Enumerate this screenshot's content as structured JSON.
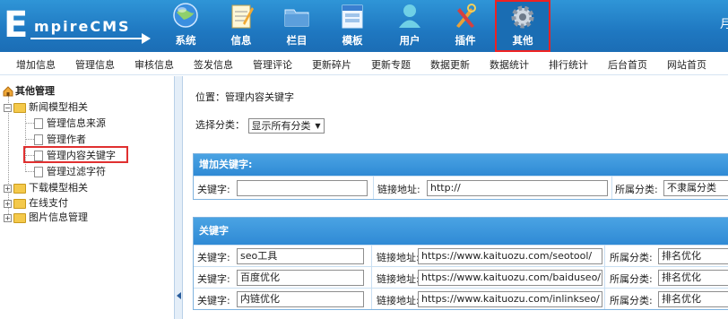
{
  "header": {
    "logo_initial": "E",
    "logo_rest": "mpireCMS",
    "nav": [
      {
        "label": "系统",
        "icon": "globe-icon"
      },
      {
        "label": "信息",
        "icon": "notepad-icon"
      },
      {
        "label": "栏目",
        "icon": "folder-icon"
      },
      {
        "label": "模板",
        "icon": "template-window-icon"
      },
      {
        "label": "用户",
        "icon": "user-icon"
      },
      {
        "label": "插件",
        "icon": "tools-icon"
      },
      {
        "label": "其他",
        "icon": "gear-icon"
      }
    ],
    "right_text": "月"
  },
  "subnav": [
    "增加信息",
    "管理信息",
    "审核信息",
    "签发信息",
    "管理评论",
    "更新碎片",
    "更新专题",
    "数据更新",
    "数据统计",
    "排行统计",
    "后台首页",
    "网站首页"
  ],
  "sidebar": {
    "root": "其他管理",
    "groups": [
      {
        "label": "新闻模型相关",
        "children": [
          "管理信息来源",
          "管理作者",
          "管理内容关键字",
          "管理过滤字符"
        ]
      },
      {
        "label": "下载模型相关"
      },
      {
        "label": "在线支付"
      },
      {
        "label": "图片信息管理"
      }
    ],
    "selected": "管理内容关键字"
  },
  "main": {
    "breadcrumb": "位置：管理内容关键字",
    "filter_label": "选择分类：",
    "filter_value": "显示所有分类",
    "add_panel": {
      "title": "增加关键字:",
      "keyword_label": "关键字:",
      "keyword_value": "",
      "link_label": "链接地址:",
      "link_value": "http://",
      "category_label": "所属分类:",
      "category_value": "不隶属分类"
    },
    "list_panel": {
      "title": "关键字",
      "keyword_label": "关键字:",
      "link_label": "链接地址:",
      "category_label": "所属分类:",
      "rows": [
        {
          "keyword": "seo工具",
          "link": "https://www.kaituozu.com/seotool/",
          "category": "排名优化"
        },
        {
          "keyword": "百度优化",
          "link": "https://www.kaituozu.com/baiduseo/",
          "category": "排名优化"
        },
        {
          "keyword": "内链优化",
          "link": "https://www.kaituozu.com/inlinkseo/",
          "category": "排名优化"
        }
      ]
    }
  },
  "colors": {
    "header_blue": "#1f78c1",
    "panel_head": "#3493d9",
    "highlight_red": "#e03030"
  }
}
